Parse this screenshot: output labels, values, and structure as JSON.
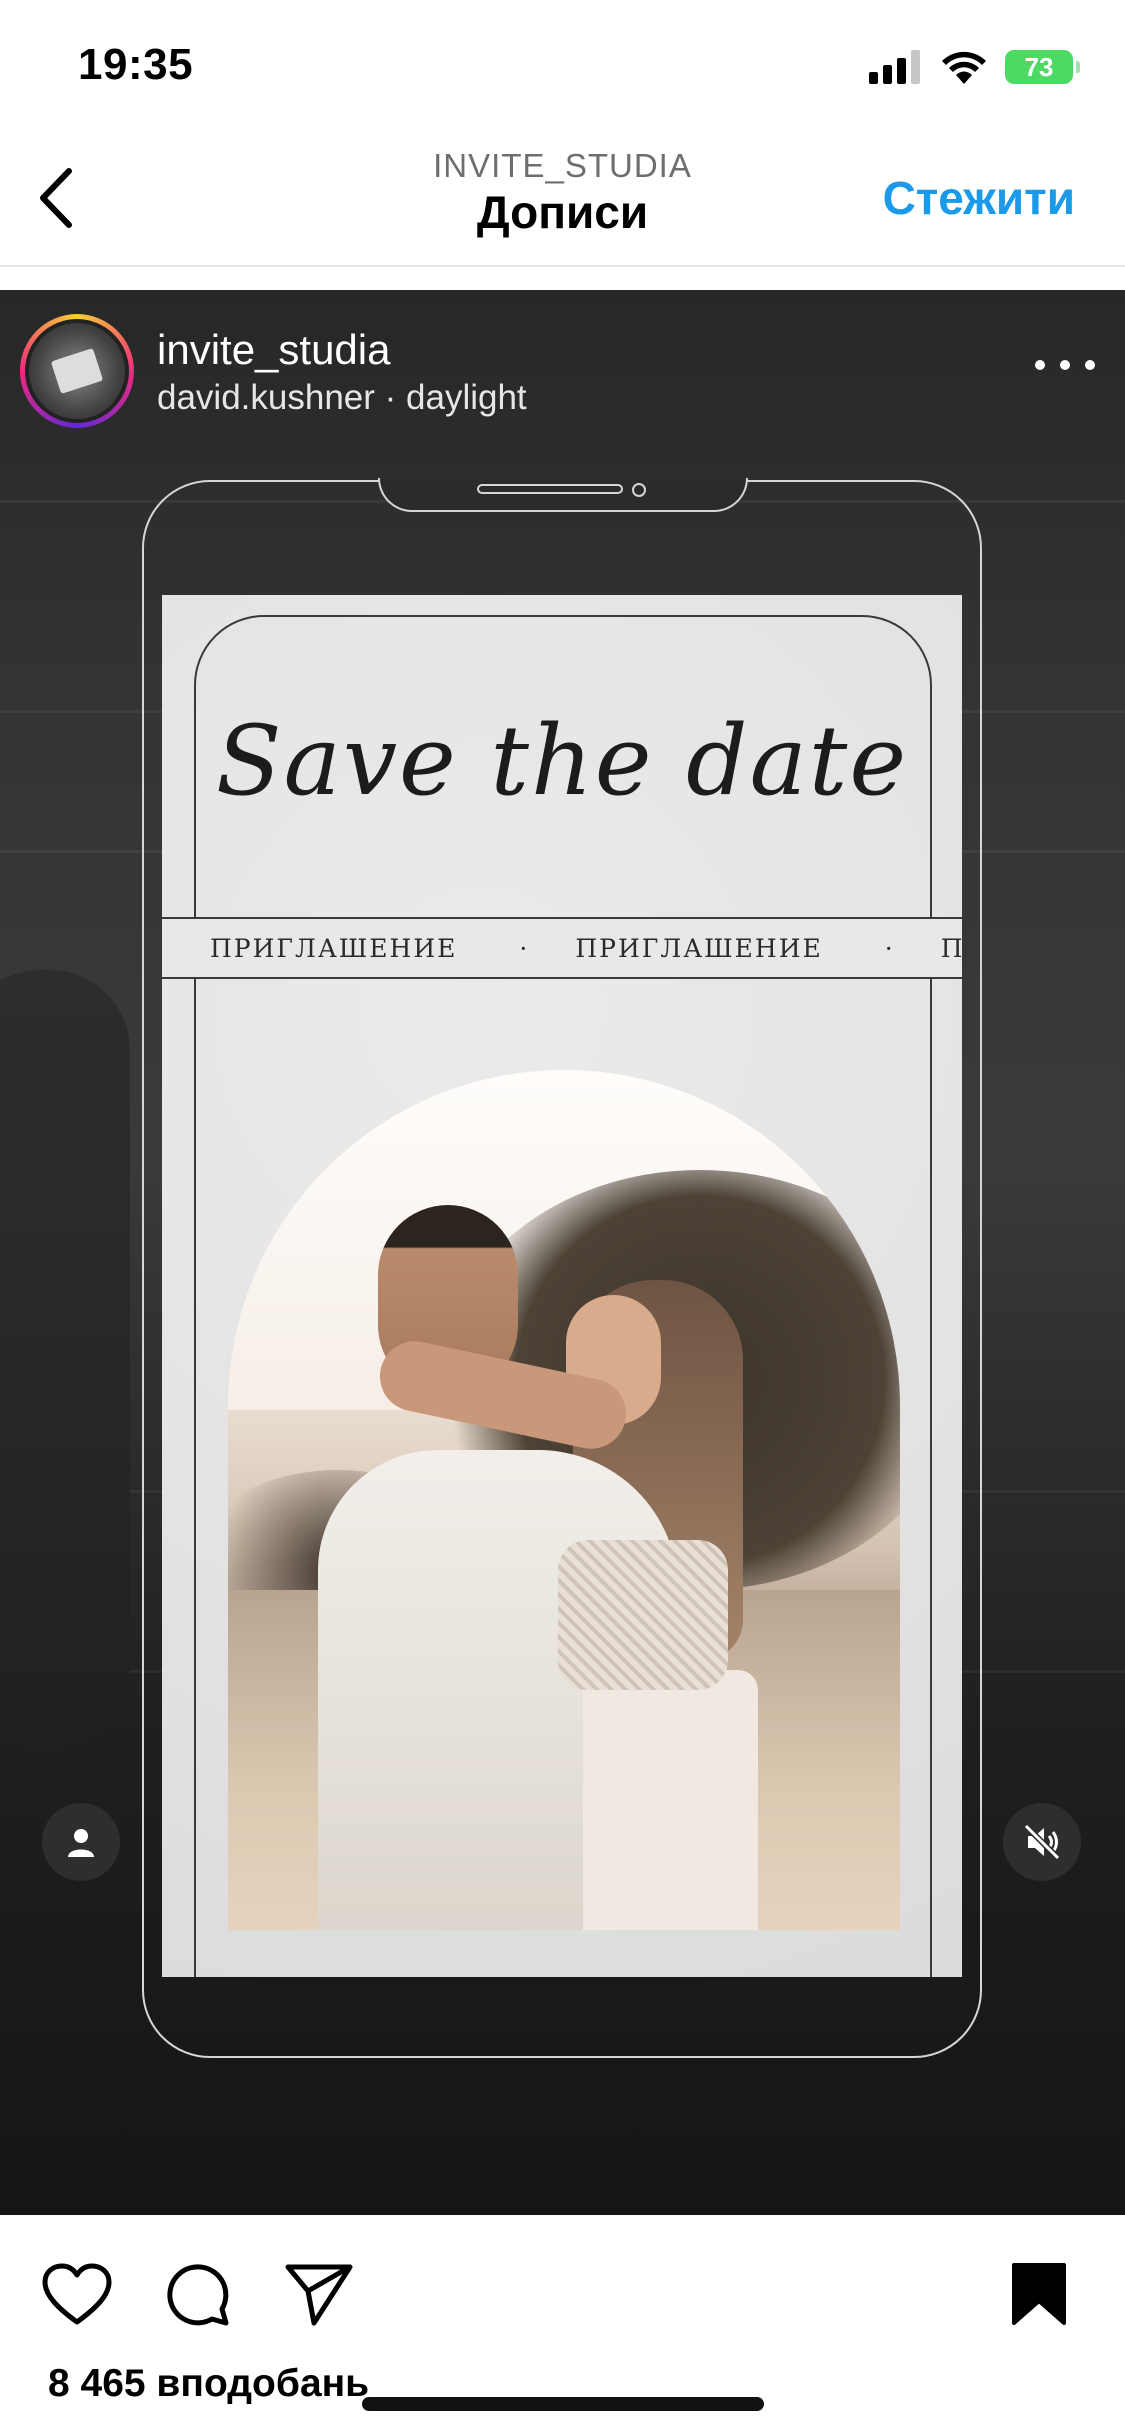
{
  "status_bar": {
    "time": "19:35",
    "battery": "73",
    "icons": [
      "signal-icon",
      "wifi-icon",
      "battery-charging-icon"
    ]
  },
  "header": {
    "account": "INVITE_STUDIA",
    "title": "Дописи",
    "follow_label": "Стежити",
    "accent_color": "#1a9ae8"
  },
  "post": {
    "username": "invite_studia",
    "audio": "david.kushner · daylight",
    "card": {
      "headline": "Save the date",
      "ribbon_items": [
        "ПРИГЛАШЕНИЕ",
        "·",
        "ПРИГЛАШЕНИЕ",
        "·",
        "П"
      ]
    },
    "likes": "8 465 вподобань"
  },
  "icons": {
    "back": "chevron-left-icon",
    "more": "more-dots-icon",
    "tags": "user-tag-icon",
    "mute": "speaker-muted-icon",
    "like": "heart-icon",
    "comment": "comment-icon",
    "share": "send-icon",
    "save": "bookmark-icon"
  }
}
